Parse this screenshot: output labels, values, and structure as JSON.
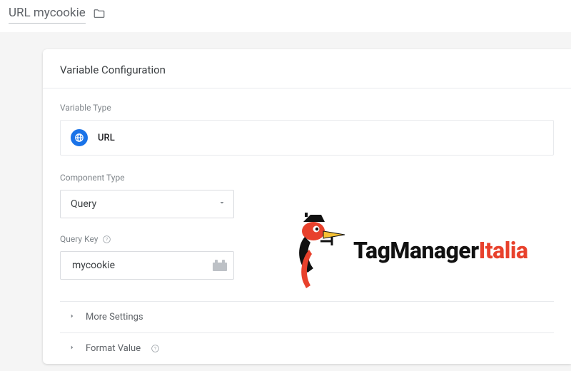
{
  "header": {
    "variable_name": "URL mycookie"
  },
  "card": {
    "title": "Variable Configuration",
    "variable_type_label": "Variable Type",
    "variable_type_value": "URL",
    "component_type_label": "Component Type",
    "component_type_value": "Query",
    "query_key_label": "Query Key",
    "query_key_value": "mycookie",
    "more_settings": "More Settings",
    "format_value": "Format Value"
  },
  "watermark": {
    "text1": "TagManager",
    "text2": "Italia"
  }
}
